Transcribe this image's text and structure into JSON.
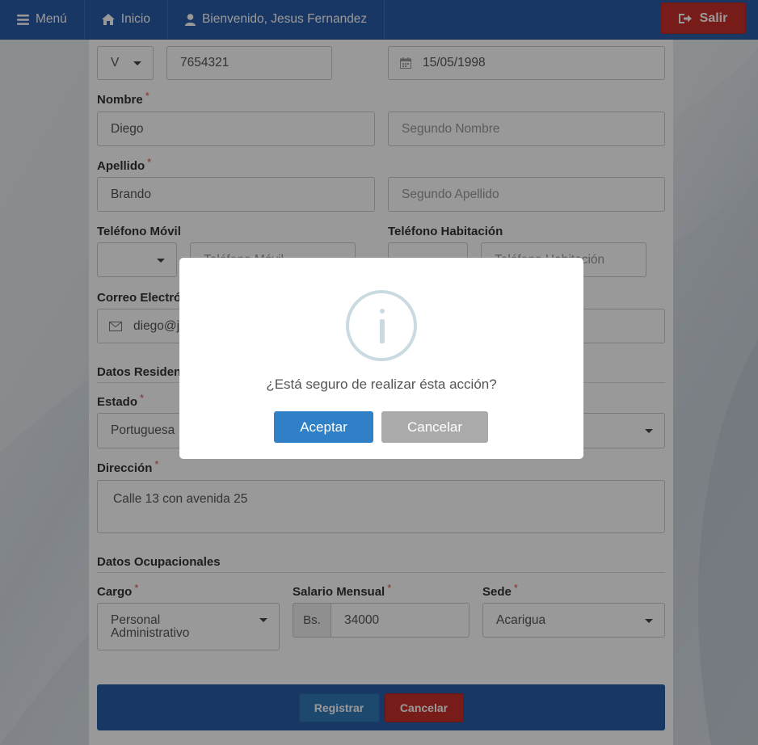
{
  "navbar": {
    "menu_label": "Menú",
    "home_label": "Inicio",
    "welcome_label": "Bienvenido, Jesus Fernandez",
    "logout_label": "Salir"
  },
  "form": {
    "doc_type": "V",
    "doc_number": "7654321",
    "birth_date": "15/05/1998",
    "nombre_label": "Nombre",
    "first_name": "Diego",
    "second_name_placeholder": "Segundo Nombre",
    "apellido_label": "Apellido",
    "last_name": "Brando",
    "second_lastname_placeholder": "Segundo Apellido",
    "mobile_label": "Teléfono Móvil",
    "mobile_placeholder": "Teléfono Móvil",
    "home_phone_label": "Teléfono Habitación",
    "home_phone_placeholder": "Teléfono Habitación",
    "email_label": "Correo Electrónico",
    "email_value": "diego@jm",
    "residence_section": "Datos Residenciales",
    "estado_label": "Estado",
    "estado_value": "Portuguesa",
    "direccion_label": "Dirección",
    "direccion_value": "Calle 13 con avenida 25",
    "occupation_section": "Datos Ocupacionales",
    "cargo_label": "Cargo",
    "cargo_value_line1": "Personal",
    "cargo_value_line2": "Administrativo",
    "salary_label": "Salario Mensual",
    "salary_prefix": "Bs.",
    "salary_value": "34000",
    "sede_label": "Sede",
    "sede_value": "Acarigua",
    "register_button": "Registrar",
    "cancel_button": "Cancelar"
  },
  "modal": {
    "message": "¿Está seguro de realizar ésta acción?",
    "confirm_label": "Aceptar",
    "cancel_label": "Cancelar",
    "icon": "info-icon"
  },
  "colors": {
    "navbar": "#2a5ca8",
    "danger": "#c9302c",
    "primary": "#2f80c7"
  }
}
